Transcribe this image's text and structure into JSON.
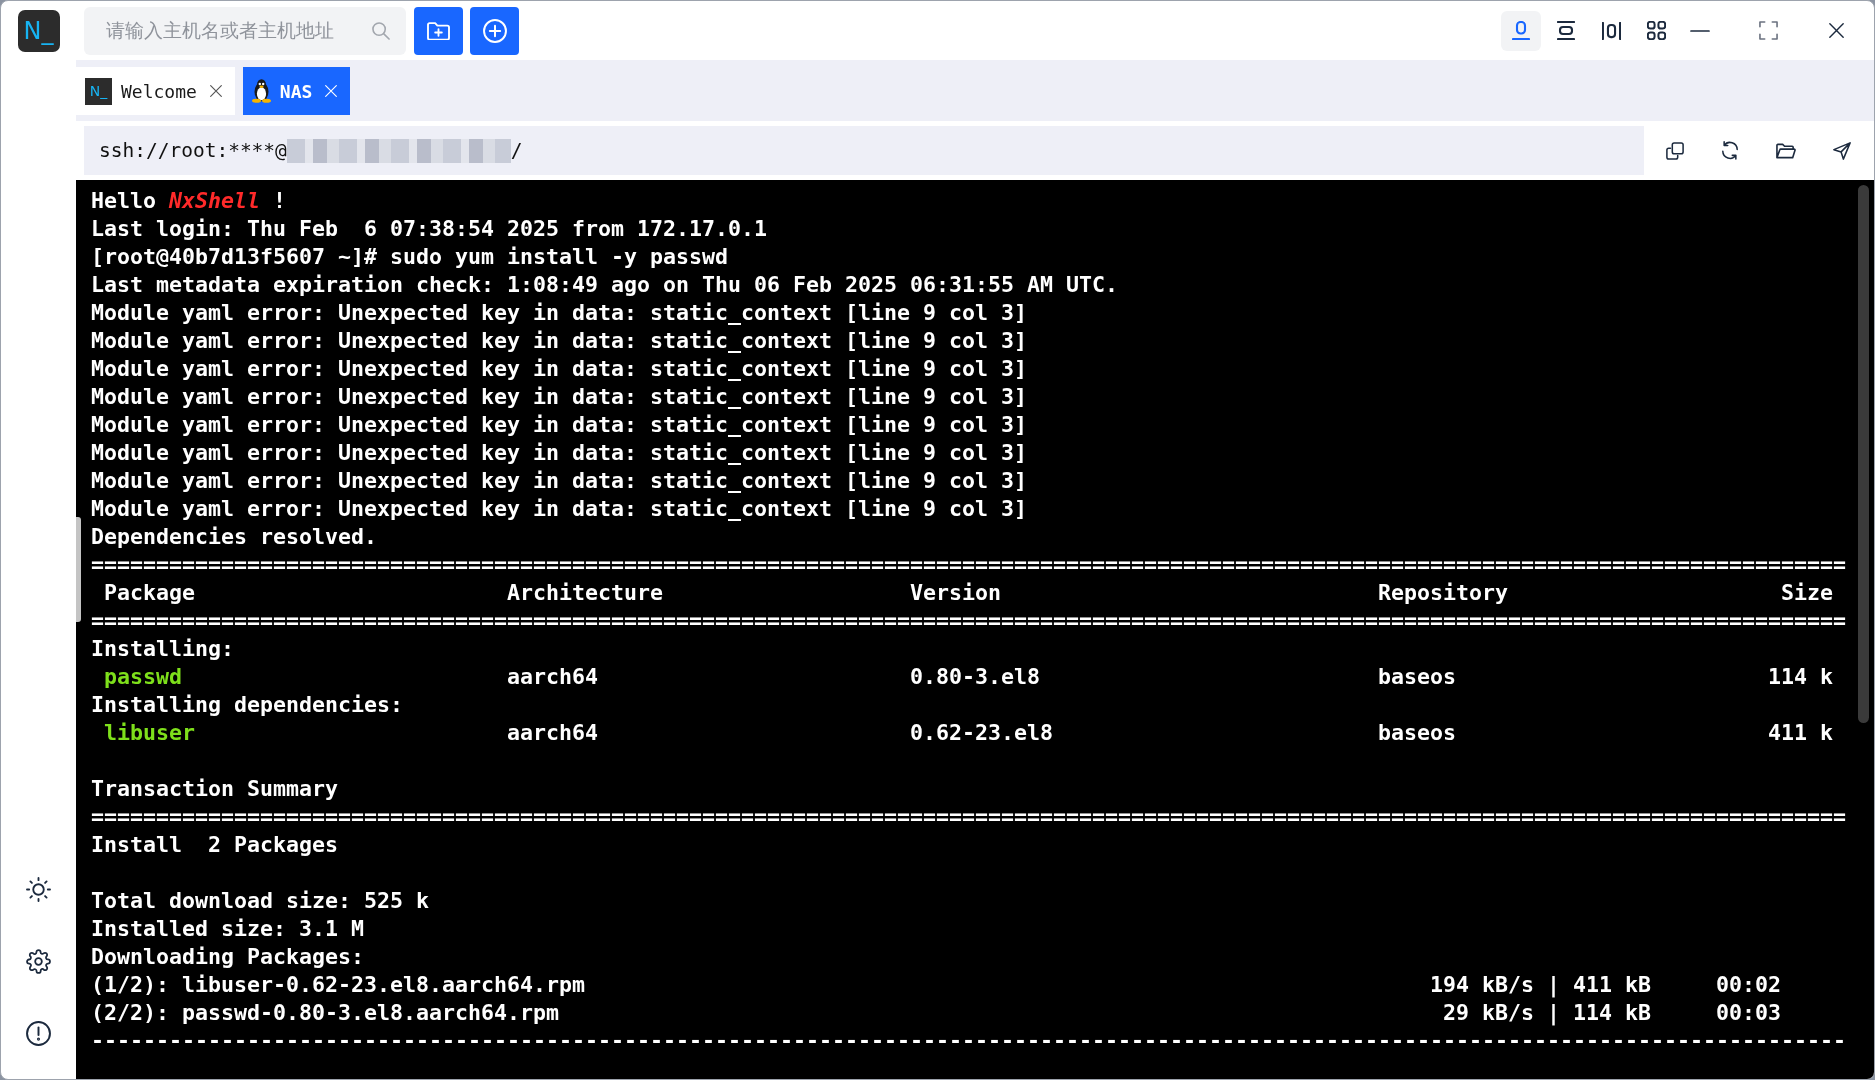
{
  "app": {
    "logo": "N_"
  },
  "search": {
    "placeholder": "请输入主机名或者主机地址"
  },
  "layout_buttons": [
    {
      "kind": "single",
      "selected": true
    },
    {
      "kind": "rows",
      "selected": false
    },
    {
      "kind": "columns",
      "selected": false
    },
    {
      "kind": "grid",
      "selected": false
    }
  ],
  "tabs": [
    {
      "kind": "welcome",
      "badge": "N_",
      "label": "Welcome",
      "selected": false
    },
    {
      "kind": "ssh",
      "label": "NAS",
      "selected": true
    }
  ],
  "address": {
    "prefix": "ssh://root:****@",
    "host_redacted": true,
    "suffix": "/"
  },
  "terminal": {
    "lines": [
      {
        "kind": "text",
        "text": "Hello *NxShell* !"
      },
      {
        "kind": "text",
        "text": "Last login: Thu Feb  6 07:38:54 2025 from 172.17.0.1"
      },
      {
        "kind": "text",
        "text": "[root@40b7d13f5607 ~]# sudo yum install -y passwd"
      },
      {
        "kind": "text",
        "text": "Last metadata expiration check: 1:08:49 ago on Thu 06 Feb 2025 06:31:55 AM UTC."
      },
      {
        "kind": "text",
        "text": "Module yaml error: Unexpected key in data: static_context [line 9 col 3]"
      },
      {
        "kind": "text",
        "text": "Module yaml error: Unexpected key in data: static_context [line 9 col 3]"
      },
      {
        "kind": "text",
        "text": "Module yaml error: Unexpected key in data: static_context [line 9 col 3]"
      },
      {
        "kind": "text",
        "text": "Module yaml error: Unexpected key in data: static_context [line 9 col 3]"
      },
      {
        "kind": "text",
        "text": "Module yaml error: Unexpected key in data: static_context [line 9 col 3]"
      },
      {
        "kind": "text",
        "text": "Module yaml error: Unexpected key in data: static_context [line 9 col 3]"
      },
      {
        "kind": "text",
        "text": "Module yaml error: Unexpected key in data: static_context [line 9 col 3]"
      },
      {
        "kind": "text",
        "text": "Module yaml error: Unexpected key in data: static_context [line 9 col 3]"
      },
      {
        "kind": "text",
        "text": "Dependencies resolved."
      },
      {
        "kind": "rule",
        "text": "======================================================================================================================================="
      },
      {
        "kind": "header",
        "cells": [
          "Package",
          "Architecture",
          "Version",
          "Repository",
          "Size"
        ]
      },
      {
        "kind": "rule",
        "text": "======================================================================================================================================="
      },
      {
        "kind": "text",
        "text": "Installing:"
      },
      {
        "kind": "package",
        "cells": [
          "passwd",
          "aarch64",
          "0.80-3.el8",
          "baseos",
          "114 k"
        ]
      },
      {
        "kind": "text",
        "text": "Installing dependencies:"
      },
      {
        "kind": "package",
        "cells": [
          "libuser",
          "aarch64",
          "0.62-23.el8",
          "baseos",
          "411 k"
        ]
      },
      {
        "kind": "blank"
      },
      {
        "kind": "text",
        "text": "Transaction Summary"
      },
      {
        "kind": "rule",
        "text": "======================================================================================================================================="
      },
      {
        "kind": "text",
        "text": "Install  2 Packages"
      },
      {
        "kind": "blank"
      },
      {
        "kind": "text",
        "text": "Total download size: 525 k"
      },
      {
        "kind": "text",
        "text": "Installed size: 3.1 M"
      },
      {
        "kind": "text",
        "text": "Downloading Packages:"
      },
      {
        "kind": "download",
        "file": "(1/2): libuser-0.62-23.el8.aarch64.rpm",
        "stats": "194 kB/s | 411 kB     00:02"
      },
      {
        "kind": "download",
        "file": "(2/2): passwd-0.80-3.el8.aarch64.rpm",
        "stats": "29 kB/s | 114 kB     00:03"
      },
      {
        "kind": "rule",
        "text": "---------------------------------------------------------------------------------------------------------------------------------------"
      }
    ]
  }
}
